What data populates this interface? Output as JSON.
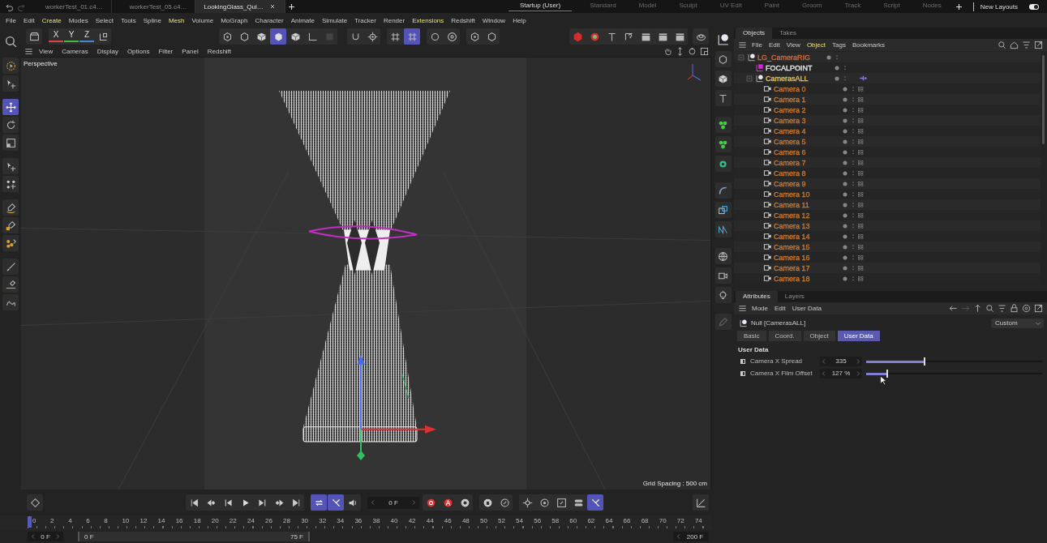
{
  "title_bar": {
    "tabs": [
      {
        "label": "workerTest_01.c4…",
        "selected": false
      },
      {
        "label": "workerTest_05.c4…",
        "selected": false
      },
      {
        "label": "LookingGlass_Qui…",
        "selected": true
      }
    ],
    "layouts": [
      {
        "label": "Startup (User)",
        "selected": true
      },
      {
        "label": "Standard",
        "selected": false
      },
      {
        "label": "Model",
        "selected": false
      },
      {
        "label": "Sculpt",
        "selected": false
      },
      {
        "label": "UV Edit",
        "selected": false
      },
      {
        "label": "Paint",
        "selected": false
      },
      {
        "label": "Groom",
        "selected": false
      },
      {
        "label": "Track",
        "selected": false
      },
      {
        "label": "Script",
        "selected": false
      },
      {
        "label": "Nodes",
        "selected": false
      }
    ],
    "new_layouts": "New Layouts",
    "toggle_on": true
  },
  "menu_bar": [
    {
      "label": "File",
      "accent": false
    },
    {
      "label": "Edit",
      "accent": false
    },
    {
      "label": "Create",
      "accent": true
    },
    {
      "label": "Modes",
      "accent": false
    },
    {
      "label": "Select",
      "accent": false
    },
    {
      "label": "Tools",
      "accent": false
    },
    {
      "label": "Spline",
      "accent": false
    },
    {
      "label": "Mesh",
      "accent": true
    },
    {
      "label": "Volume",
      "accent": false
    },
    {
      "label": "MoGraph",
      "accent": false
    },
    {
      "label": "Character",
      "accent": false
    },
    {
      "label": "Animate",
      "accent": false
    },
    {
      "label": "Simulate",
      "accent": false
    },
    {
      "label": "Tracker",
      "accent": false
    },
    {
      "label": "Render",
      "accent": false
    },
    {
      "label": "Extensions",
      "accent": true
    },
    {
      "label": "Redshift",
      "accent": false
    },
    {
      "label": "Window",
      "accent": false
    },
    {
      "label": "Help",
      "accent": false
    }
  ],
  "toolbar": {
    "axes": [
      "X",
      "Y",
      "Z"
    ]
  },
  "viewport": {
    "menu": [
      "View",
      "Cameras",
      "Display",
      "Options",
      "Filter",
      "Panel",
      "Redshift"
    ],
    "view_name": "Perspective",
    "grid_spacing": "Grid Spacing : 500 cm"
  },
  "objects_panel": {
    "tabs": [
      {
        "label": "Objects",
        "selected": true
      },
      {
        "label": "Takes",
        "selected": false
      }
    ],
    "menu": [
      {
        "label": "File",
        "accent": false
      },
      {
        "label": "Edit",
        "accent": false
      },
      {
        "label": "View",
        "accent": false
      },
      {
        "label": "Object",
        "accent": true
      },
      {
        "label": "Tags",
        "accent": false
      },
      {
        "label": "Bookmarks",
        "accent": false
      }
    ],
    "tree": [
      {
        "name": "LG_CameraRIG",
        "kind": "null",
        "color": "#d0683a",
        "expanded": true,
        "children": [
          {
            "name": "FOCALPOINT",
            "kind": "point",
            "color": "#e8e8e8"
          },
          {
            "name": "CamerasALL",
            "kind": "null",
            "color": "#e6c04a",
            "expanded": true,
            "tagged": true,
            "children": [
              {
                "name": "Camera 0",
                "kind": "camera",
                "color": "#c9782e"
              },
              {
                "name": "Camera 1",
                "kind": "camera",
                "color": "#c9782e"
              },
              {
                "name": "Camera 2",
                "kind": "camera",
                "color": "#c9782e"
              },
              {
                "name": "Camera 3",
                "kind": "camera",
                "color": "#c9782e"
              },
              {
                "name": "Camera 4",
                "kind": "camera",
                "color": "#c9782e"
              },
              {
                "name": "Camera 5",
                "kind": "camera",
                "color": "#c9782e"
              },
              {
                "name": "Camera 6",
                "kind": "camera",
                "color": "#c9782e"
              },
              {
                "name": "Camera 7",
                "kind": "camera",
                "color": "#c9782e"
              },
              {
                "name": "Camera 8",
                "kind": "camera",
                "color": "#c9782e"
              },
              {
                "name": "Camera 9",
                "kind": "camera",
                "color": "#c9782e"
              },
              {
                "name": "Camera 10",
                "kind": "camera",
                "color": "#c9782e"
              },
              {
                "name": "Camera 11",
                "kind": "camera",
                "color": "#c9782e"
              },
              {
                "name": "Camera 12",
                "kind": "camera",
                "color": "#c9782e"
              },
              {
                "name": "Camera 13",
                "kind": "camera",
                "color": "#c9782e"
              },
              {
                "name": "Camera 14",
                "kind": "camera",
                "color": "#c9782e"
              },
              {
                "name": "Camera 15",
                "kind": "camera",
                "color": "#c9782e"
              },
              {
                "name": "Camera 16",
                "kind": "camera",
                "color": "#c9782e"
              },
              {
                "name": "Camera 17",
                "kind": "camera",
                "color": "#c9782e"
              },
              {
                "name": "Camera 18",
                "kind": "camera",
                "color": "#c9782e"
              }
            ]
          }
        ]
      }
    ]
  },
  "attributes_panel": {
    "tabs": [
      {
        "label": "Attributes",
        "selected": true
      },
      {
        "label": "Layers",
        "selected": false
      }
    ],
    "menu": [
      "Mode",
      "Edit",
      "User Data"
    ],
    "object_label": "Null [CamerasALL]",
    "preset": "Custom",
    "subtabs": [
      {
        "label": "Basic",
        "selected": false
      },
      {
        "label": "Coord.",
        "selected": false
      },
      {
        "label": "Object",
        "selected": false
      },
      {
        "label": "User Data",
        "selected": true
      }
    ],
    "section": "User Data",
    "params": [
      {
        "label": "Camera X Spread",
        "value": "335",
        "level": 0.33
      },
      {
        "label": "Camera X Film Offset",
        "value": "127 %",
        "level": 0.12
      }
    ]
  },
  "timeline": {
    "current_frame": "0 F",
    "ruler": {
      "labels": [
        "0",
        "2",
        "4",
        "6",
        "8",
        "10",
        "12",
        "14",
        "16",
        "18",
        "20",
        "22",
        "24",
        "26",
        "28",
        "30",
        "32",
        "34",
        "36",
        "38",
        "40",
        "42",
        "44",
        "46",
        "48",
        "50",
        "52",
        "54",
        "56",
        "58",
        "60",
        "62",
        "64",
        "66",
        "68",
        "70",
        "72",
        "74"
      ],
      "level": 0
    },
    "start": "0 F",
    "range_start": "0 F",
    "range_end": "75 F",
    "end": "200 F"
  }
}
